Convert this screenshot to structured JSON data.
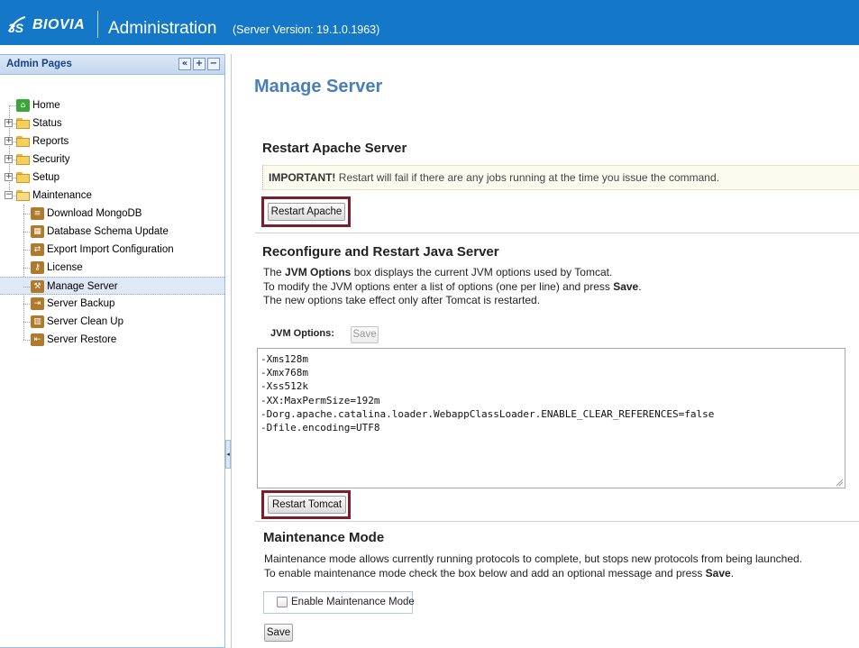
{
  "header": {
    "brand": "BIOVIA",
    "app_title": "Administration",
    "server_version": "(Server Version: 19.1.0.1963)",
    "colors": {
      "bar": "#1577c7"
    }
  },
  "sidebar": {
    "title": "Admin Pages",
    "tools": [
      "«",
      "+",
      "−"
    ],
    "top_items": [
      {
        "label": "Home",
        "icon": "home-icon"
      },
      {
        "label": "Status",
        "icon": "folder-icon"
      },
      {
        "label": "Reports",
        "icon": "folder-icon"
      },
      {
        "label": "Security",
        "icon": "folder-icon"
      },
      {
        "label": "Setup",
        "icon": "folder-icon"
      },
      {
        "label": "Maintenance",
        "icon": "folder-open-icon"
      }
    ],
    "maintenance_items": [
      {
        "label": "Download MongoDB",
        "icon": "database-icon"
      },
      {
        "label": "Database Schema Update",
        "icon": "table-icon"
      },
      {
        "label": "Export Import Configuration",
        "icon": "export-import-icon"
      },
      {
        "label": "License",
        "icon": "key-icon"
      },
      {
        "label": "Manage Server",
        "icon": "hammer-icon",
        "selected": true
      },
      {
        "label": "Server Backup",
        "icon": "backup-icon"
      },
      {
        "label": "Server Clean Up",
        "icon": "trash-icon"
      },
      {
        "label": "Server Restore",
        "icon": "restore-icon"
      }
    ]
  },
  "main": {
    "page_title": "Manage Server",
    "apache": {
      "title": "Restart Apache Server",
      "important_label": "IMPORTANT!",
      "important_text": " Restart will fail if there are any jobs running at the time you issue the command.",
      "button": "Restart Apache"
    },
    "java": {
      "title": "Reconfigure and Restart Java Server",
      "line1_pre": "The ",
      "line1_bold": "JVM Options",
      "line1_post": " box displays the current JVM options used by Tomcat.",
      "line2_pre": "To modify the JVM options enter a list of options (one per line) and press ",
      "line2_bold": "Save",
      "line2_post": ".",
      "line3": "The new options take effect only after Tomcat is restarted.",
      "jvm_label": "JVM Options:",
      "save_button": "Save",
      "jvm_options": "-Xms128m\n-Xmx768m\n-Xss512k\n-XX:MaxPermSize=192m\n-Dorg.apache.catalina.loader.WebappClassLoader.ENABLE_CLEAR_REFERENCES=false\n-Dfile.encoding=UTF8",
      "restart_button": "Restart Tomcat"
    },
    "maintenance": {
      "title": "Maintenance Mode",
      "line1": "Maintenance mode allows currently running protocols to complete, but stops new protocols from being launched.",
      "line2_pre": "To enable maintenance mode check the box below and add an optional message and press ",
      "line2_bold": "Save",
      "line2_post": ".",
      "checkbox_label": "Enable Maintenance Mode",
      "checkbox_checked": false,
      "save_button": "Save"
    }
  }
}
